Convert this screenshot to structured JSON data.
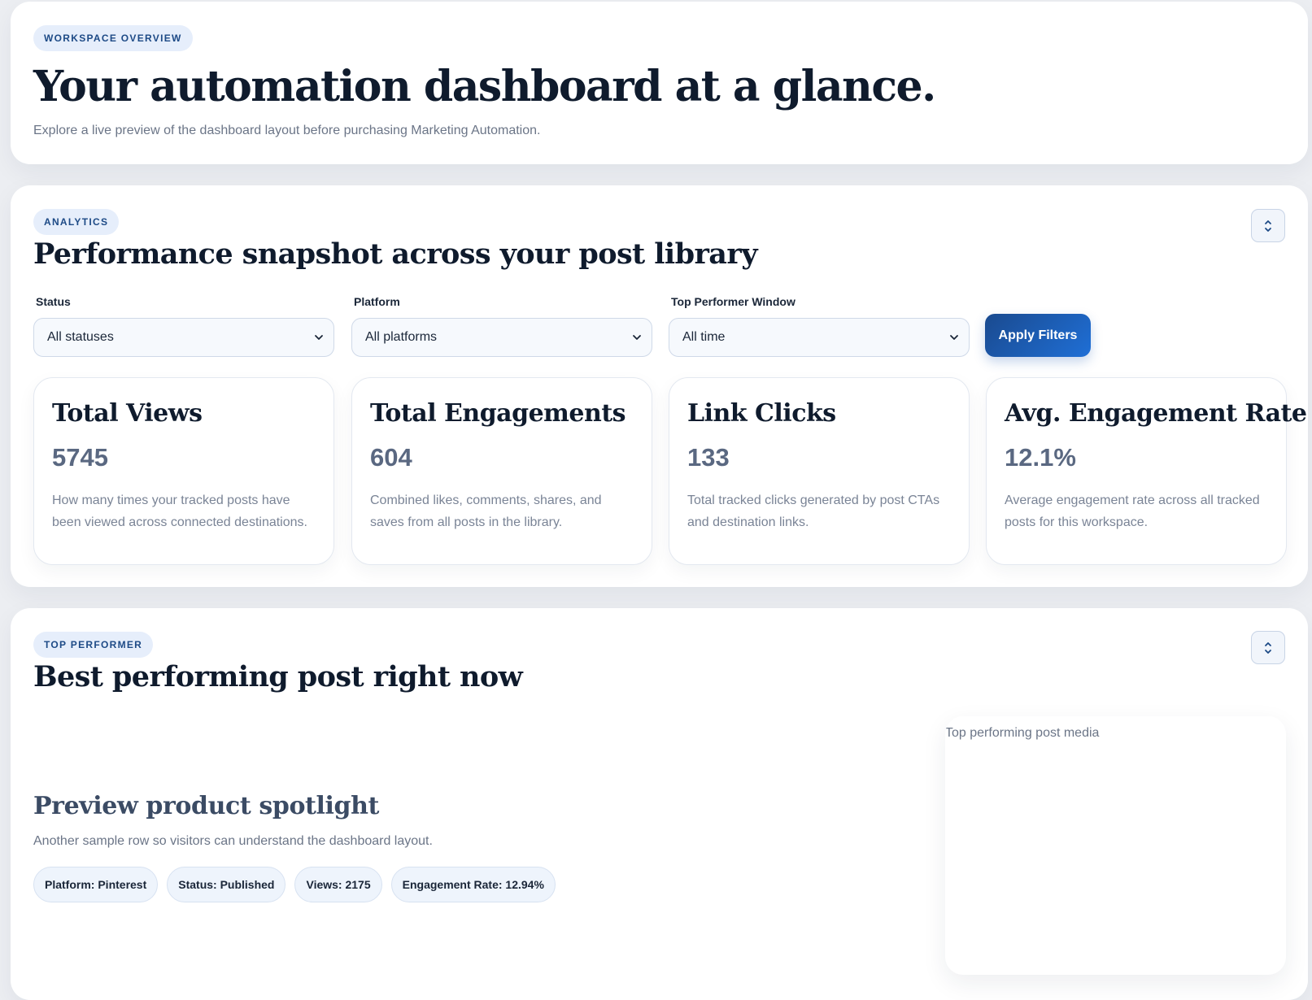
{
  "overview": {
    "tag": "WORKSPACE OVERVIEW",
    "title": "Your automation dashboard at a glance.",
    "subtitle": "Explore a live preview of the dashboard layout before purchasing Marketing Automation."
  },
  "analytics": {
    "tag": "ANALYTICS",
    "title": "Performance snapshot across your post library",
    "collapse_icon": "chevron-collapse-icon",
    "filters": [
      {
        "label": "Status",
        "value": "All statuses"
      },
      {
        "label": "Platform",
        "value": "All platforms"
      },
      {
        "label": "Top Performer Window",
        "value": "All time"
      }
    ],
    "apply_label": "Apply Filters",
    "stats": [
      {
        "title": "Total Views",
        "value": "5745",
        "description": "How many times your tracked posts have been viewed across connected destinations."
      },
      {
        "title": "Total Engagements",
        "value": "604",
        "description": "Combined likes, comments, shares, and saves from all posts in the library."
      },
      {
        "title": "Link Clicks",
        "value": "133",
        "description": "Total tracked clicks generated by post CTAs and destination links."
      },
      {
        "title": "Avg. Engagement Rate",
        "value": "12.1%",
        "description": "Average engagement rate across all tracked posts for this workspace."
      }
    ]
  },
  "top_performer": {
    "tag": "TOP PERFORMER",
    "title": "Best performing post right now",
    "post_title": "Preview product spotlight",
    "post_description": "Another sample row so visitors can understand the dashboard layout.",
    "chips": [
      "Platform: Pinterest",
      "Status: Published",
      "Views: 2175",
      "Engagement Rate: 12.94%"
    ],
    "media_alt": "Top performing post media"
  },
  "colors": {
    "accent": "#1f5fbf",
    "background": "#eceef2",
    "tag_bg": "#e6eefb",
    "tag_text": "#1d4a86"
  }
}
